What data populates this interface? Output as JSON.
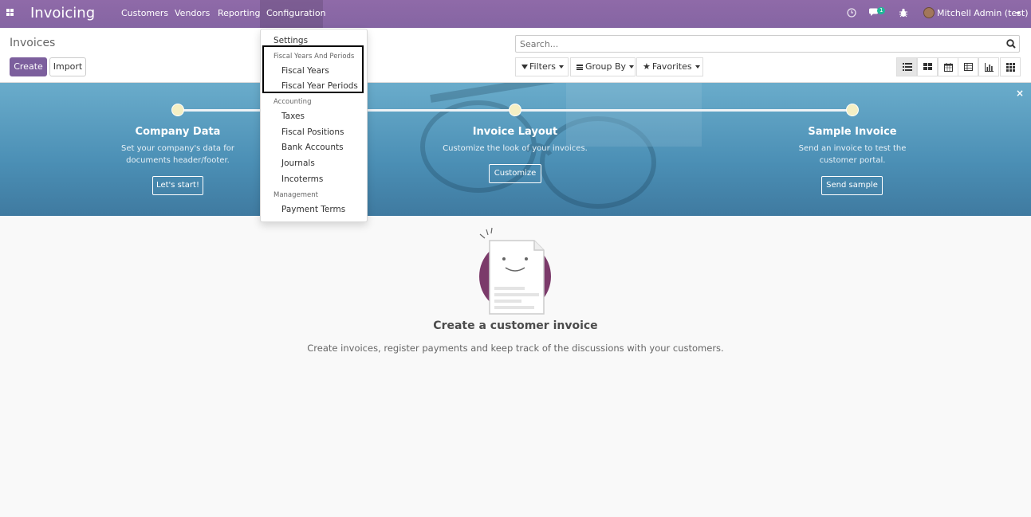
{
  "navbar": {
    "app_title": "Invoicing",
    "menu": [
      "Customers",
      "Vendors",
      "Reporting",
      "Configuration"
    ],
    "chat_count": "1",
    "user_name": "Mitchell Admin (test)"
  },
  "control_panel": {
    "title": "Invoices",
    "create_label": "Create",
    "import_label": "Import",
    "search_placeholder": "Search...",
    "filters_label": "Filters",
    "group_by_label": "Group By",
    "favorites_label": "Favorites"
  },
  "config_menu": {
    "settings": "Settings",
    "section1_header": "Fiscal Years And Periods",
    "fiscal_years": "Fiscal Years",
    "fiscal_year_periods": "Fiscal Year Periods",
    "section2_header": "Accounting",
    "taxes": "Taxes",
    "fiscal_positions": "Fiscal Positions",
    "bank_accounts": "Bank Accounts",
    "journals": "Journals",
    "incoterms": "Incoterms",
    "section3_header": "Management",
    "payment_terms": "Payment Terms"
  },
  "onboarding": {
    "steps": [
      {
        "title": "Company Data",
        "desc1": "Set your company's data for",
        "desc2": "documents header/footer.",
        "button": "Let's start!"
      },
      {
        "title": "Invoice Layout",
        "desc1": "Customize the look of your invoices.",
        "desc2": "",
        "button": "Customize"
      },
      {
        "title": "Sample Invoice",
        "desc1": "Send an invoice to test the",
        "desc2": "customer portal.",
        "button": "Send sample"
      }
    ],
    "close_symbol": "×"
  },
  "empty_state": {
    "title": "Create a customer invoice",
    "text": "Create invoices, register payments and keep track of the discussions with your customers."
  },
  "colors": {
    "brand": "#875a7b",
    "primary_button": "#7c5f9d",
    "banner": "#4b8fb5"
  }
}
